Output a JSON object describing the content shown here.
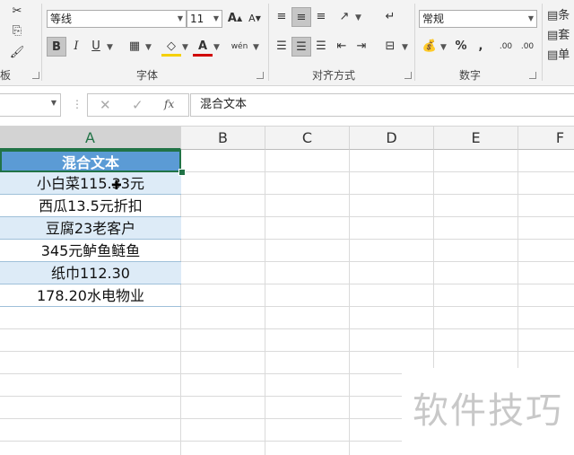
{
  "ribbon": {
    "font_name": "等线",
    "font_size": "11",
    "number_format": "常规",
    "bold_label": "B",
    "italic_label": "I",
    "underline_label": "U",
    "grow_font_label": "A",
    "shrink_font_label": "A",
    "font_color_label": "A",
    "phonetic_label": "wén",
    "percent_label": "%",
    "comma_label": ",",
    "dec_inc_label": ".00",
    "dec_dec_label": ".00",
    "group_clipboard": "板",
    "group_font": "字体",
    "group_align": "对齐方式",
    "group_number": "数字",
    "right_items": [
      "条",
      "套",
      "单"
    ]
  },
  "formula_bar": {
    "fx_label": "fx",
    "content": "混合文本"
  },
  "columns": [
    "A",
    "B",
    "C",
    "D",
    "E",
    "F"
  ],
  "cells": [
    "混合文本",
    "小白菜115.33元",
    "西瓜13.5元折扣",
    "豆腐23老客户",
    "345元鲈鱼鲢鱼",
    "纸巾112.30",
    "178.20水电物业"
  ],
  "watermark": "软件技巧",
  "colors": {
    "accent": "#217346",
    "header_fill": "#5b9bd5",
    "band_fill": "#ddebf7"
  }
}
